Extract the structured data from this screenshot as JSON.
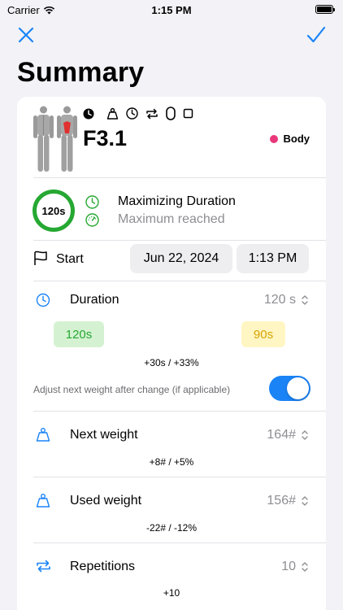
{
  "status": {
    "carrier": "Carrier",
    "time": "1:15 PM"
  },
  "page": {
    "title": "Summary"
  },
  "exercise": {
    "name": "F3.1",
    "category": "Body",
    "category_color": "#e8377a"
  },
  "goal": {
    "ring_label": "120s",
    "title": "Maximizing Duration",
    "subtitle": "Maximum reached"
  },
  "start": {
    "label": "Start",
    "date": "Jun 22, 2024",
    "time": "1:13 PM"
  },
  "duration": {
    "label": "Duration",
    "value": "120 s",
    "chip_a": "120s",
    "chip_b": "90s",
    "diff": "+30s / +33%"
  },
  "adjust": {
    "label": "Adjust next weight after change (if applicable)",
    "enabled": true
  },
  "next_weight": {
    "label": "Next weight",
    "value": "164#",
    "diff": "+8# / +5%"
  },
  "used_weight": {
    "label": "Used weight",
    "value": "156#",
    "diff": "-22# / -12%"
  },
  "repetitions": {
    "label": "Repetitions",
    "value": "10",
    "diff": "+10"
  },
  "colors": {
    "accent": "#1a84f7",
    "green": "#26a832",
    "chip_green_bg": "#d4f2d1",
    "chip_yellow_bg": "#fff6c4"
  },
  "icons": [
    "close-icon",
    "checkmark-icon",
    "body-front-icon",
    "body-back-icon",
    "clock-filled-icon",
    "weight-icon",
    "timer-icon",
    "repeat-icon",
    "capsule-icon",
    "square-icon",
    "flag-icon",
    "stopwatch-icon",
    "chevron-updown-icon"
  ]
}
